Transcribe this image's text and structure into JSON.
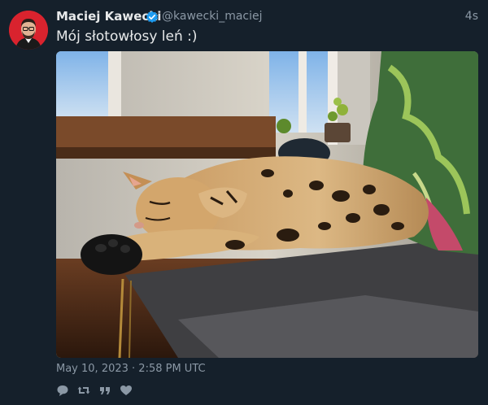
{
  "tweet": {
    "author_name": "Maciej Kawecki",
    "author_handle": "@kawecki_maciej",
    "relative_time": "4s",
    "text": "Mój słotowłosy leń :)",
    "timestamp": "May 10, 2023 · 2:58 PM UTC",
    "verified": true
  },
  "actions": [
    {
      "icon": "reply-icon"
    },
    {
      "icon": "retweet-icon"
    },
    {
      "icon": "quote-icon"
    },
    {
      "icon": "like-icon"
    }
  ],
  "colors": {
    "background": "#15202b",
    "verified_badge": "#1d9bf0",
    "muted_text": "#8b98a5",
    "avatar_bg": "#d9232e"
  }
}
